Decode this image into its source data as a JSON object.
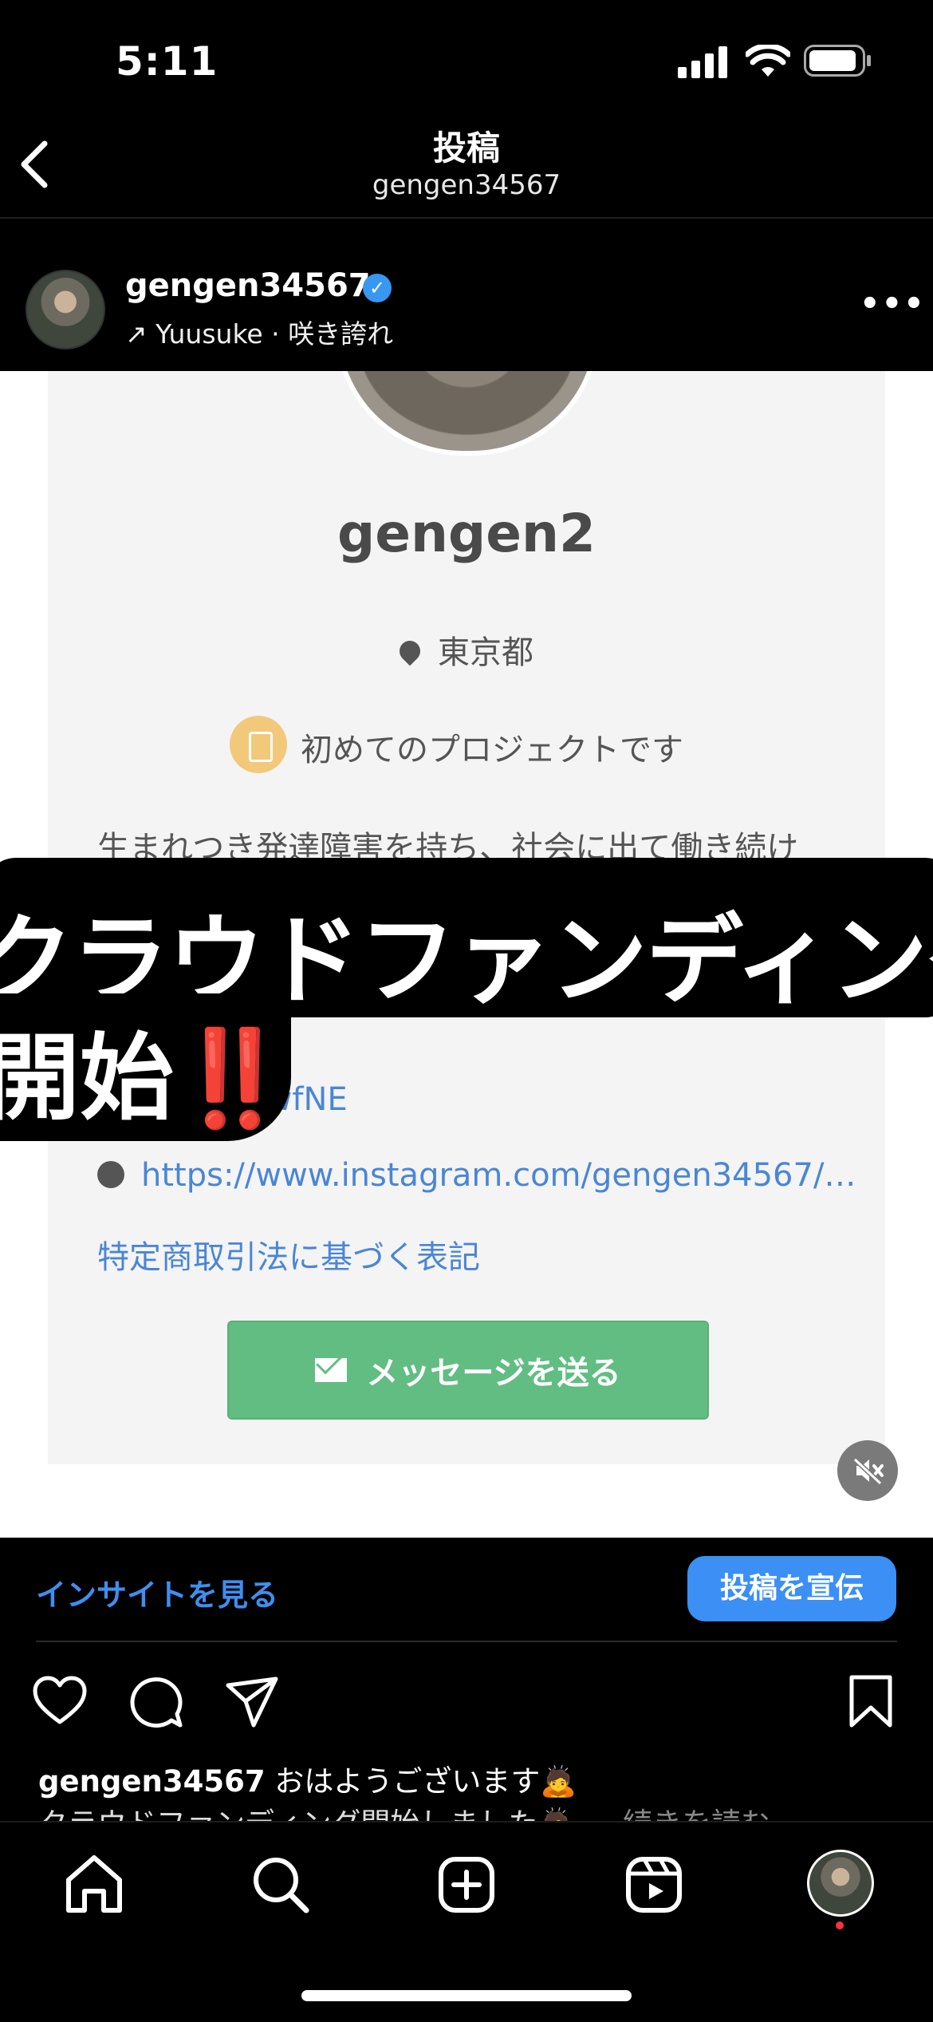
{
  "status_bar": {
    "time": "5:11"
  },
  "header": {
    "title": "投稿",
    "subtitle": "gengen34567"
  },
  "post": {
    "username": "gengen34567",
    "verified_mark": "✓",
    "music": "↗ Yuusuke · 咲き誇れ",
    "more": "•••"
  },
  "media": {
    "profile_name": "gengen2",
    "location": "東京都",
    "project_badge": "初めてのプロジェクトです",
    "bio": "生まれつき発達障害を持ち、社会に出て働き続け",
    "link_short": "…gyWUQLwfNE",
    "link_url": "https://www.instagram.com/gengen34567/…",
    "legal_link": "特定商取引法に基づく表記",
    "message_button": "メッセージを送る",
    "banner_line1": "クラウドファンディング",
    "banner_line2": "開始",
    "banner_exclaim": "‼️",
    "mute_icon": "muted-speaker"
  },
  "insights": {
    "view": "インサイトを見る",
    "promote": "投稿を宣伝"
  },
  "caption": {
    "username": "gengen34567",
    "text": " おはようございます🙇",
    "line2": "クラウドファンディング開始しました🙇",
    "more": "… 続きを読む"
  },
  "colors": {
    "accent_blue": "#3b8ff5",
    "link_blue": "#4a86d4",
    "button_green": "#62bd83",
    "notif": "#ff3040"
  }
}
